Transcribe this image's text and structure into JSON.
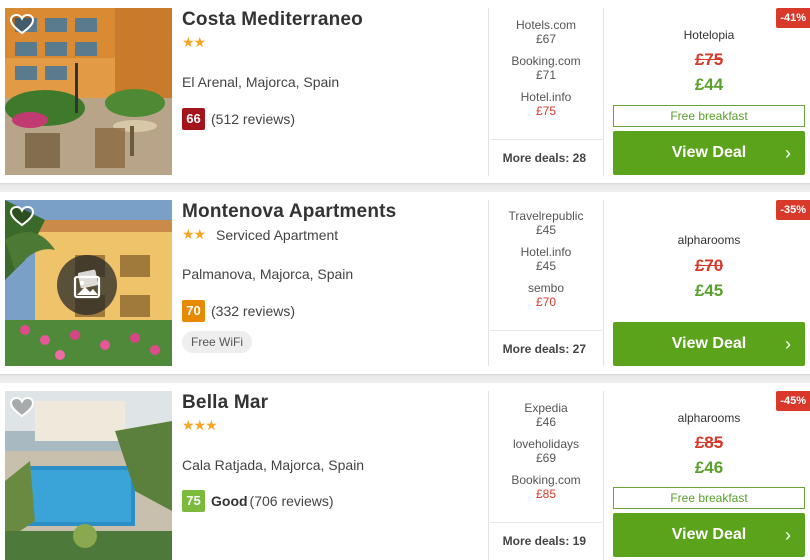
{
  "hotels": [
    {
      "name": "Costa Mediterraneo",
      "stars": "★★",
      "type": "",
      "location": "El Arenal, Majorca, Spain",
      "score": "66",
      "score_color": "#a3141b",
      "score_label": "",
      "reviews": "(512 reviews)",
      "amenity": "",
      "deals": [
        {
          "site": "Hotels.com",
          "price": "£67"
        },
        {
          "site": "Booking.com",
          "price": "£71"
        },
        {
          "site": "Hotel.info",
          "price": "£75"
        }
      ],
      "more_deals": "More deals: 28",
      "discount": "-41%",
      "provider": "Hotelopia",
      "old_price": "£75",
      "new_price": "£44",
      "free_breakfast": "Free breakfast",
      "cta": "View Deal"
    },
    {
      "name": "Montenova Apartments",
      "stars": "★★",
      "type": "Serviced Apartment",
      "location": "Palmanova, Majorca, Spain",
      "score": "70",
      "score_color": "#e78a00",
      "score_label": "",
      "reviews": "(332 reviews)",
      "amenity": "Free WiFi",
      "deals": [
        {
          "site": "Travelrepublic",
          "price": "£45"
        },
        {
          "site": "Hotel.info",
          "price": "£45"
        },
        {
          "site": "sembo",
          "price": "£70"
        }
      ],
      "more_deals": "More deals: 27",
      "discount": "-35%",
      "provider": "alpharooms",
      "old_price": "£70",
      "new_price": "£45",
      "free_breakfast": "",
      "cta": "View Deal"
    },
    {
      "name": "Bella Mar",
      "stars": "★★★",
      "type": "",
      "location": "Cala Ratjada, Majorca, Spain",
      "score": "75",
      "score_color": "#7cba3c",
      "score_label": "Good",
      "reviews": "(706 reviews)",
      "amenity": "",
      "deals": [
        {
          "site": "Expedia",
          "price": "£46"
        },
        {
          "site": "loveholidays",
          "price": "£69"
        },
        {
          "site": "Booking.com",
          "price": "£85"
        }
      ],
      "more_deals": "More deals: 19",
      "discount": "-45%",
      "provider": "alpharooms",
      "old_price": "£85",
      "new_price": "£46",
      "free_breakfast": "Free breakfast",
      "cta": "View Deal"
    }
  ],
  "icons": {
    "favorite": "heart-outline-icon",
    "gallery": "gallery-icon",
    "chevron": "chevron-right-icon"
  },
  "colors": {
    "cta_green": "#5ba31b",
    "discount_red": "#d9392b",
    "star_orange": "#f5a623",
    "price_green": "#5aa02c"
  }
}
